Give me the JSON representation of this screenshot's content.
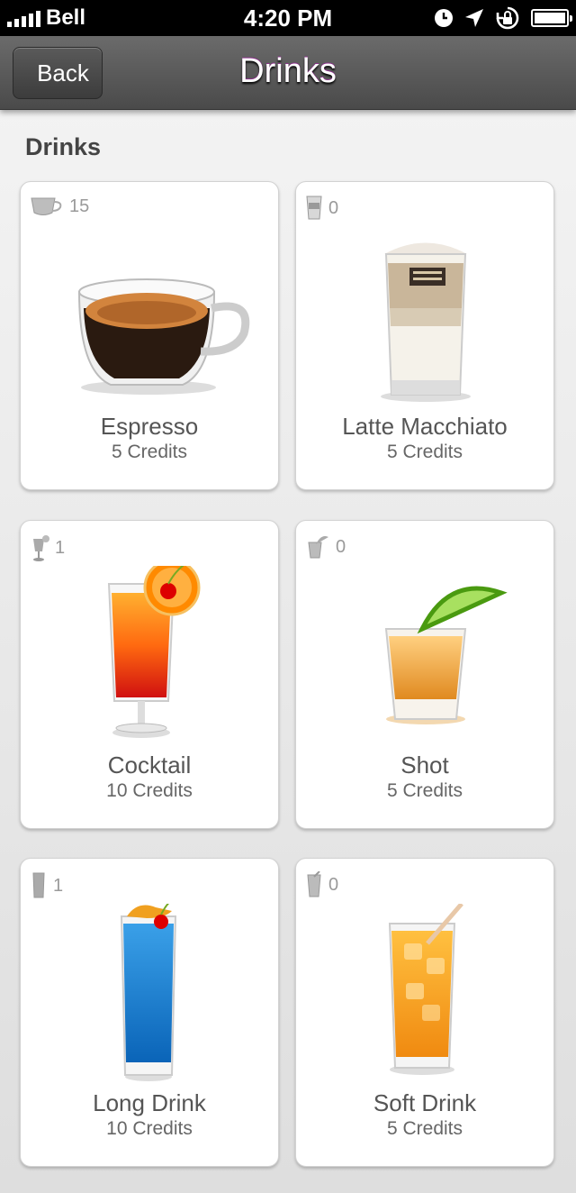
{
  "status_bar": {
    "carrier": "Bell",
    "time": "4:20 PM",
    "icons": [
      "signal-icon",
      "clock-icon",
      "location-icon",
      "rotation-lock-icon",
      "battery-icon"
    ]
  },
  "nav": {
    "title": "Drinks",
    "back_label": "Back"
  },
  "section": {
    "title": "Drinks"
  },
  "drinks": [
    {
      "name": "Espresso",
      "credits": "5 Credits",
      "count": "15",
      "icon": "espresso-cup-icon"
    },
    {
      "name": "Latte Macchiato",
      "credits": "5 Credits",
      "count": "0",
      "icon": "latte-glass-icon"
    },
    {
      "name": "Cocktail",
      "credits": "10 Credits",
      "count": "1",
      "icon": "cocktail-glass-icon"
    },
    {
      "name": "Shot",
      "credits": "5 Credits",
      "count": "0",
      "icon": "shot-glass-icon"
    },
    {
      "name": "Long Drink",
      "credits": "10 Credits",
      "count": "1",
      "icon": "long-drink-glass-icon"
    },
    {
      "name": "Soft Drink",
      "credits": "5 Credits",
      "count": "0",
      "icon": "soft-drink-glass-icon"
    }
  ],
  "colors": {
    "nav_bar": "#555555",
    "background": "#ececec",
    "card": "#ffffff",
    "text": "#555555"
  }
}
